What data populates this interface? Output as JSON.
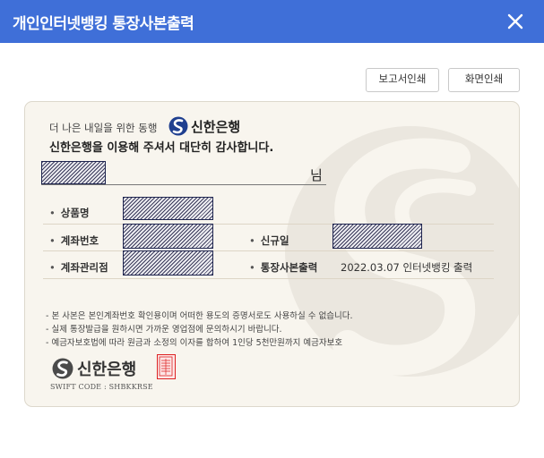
{
  "window": {
    "title": "개인인터넷뱅킹 통장사본출력"
  },
  "toolbar": {
    "report_print": "보고서인쇄",
    "screen_print": "화면인쇄"
  },
  "greeting": {
    "line1": "더 나은 내일을 위한 동행",
    "brand": "신한은행",
    "line2": "신한은행을 이용해 주셔서 대단히 감사합니다."
  },
  "customer": {
    "suffix": "님"
  },
  "fields": {
    "product_label": "상품명",
    "account_label": "계좌번호",
    "new_label": "신규일",
    "branch_label": "계좌관리점",
    "print_label": "통장사본출력",
    "print_value": "2022.03.07 인터넷뱅킹 출력"
  },
  "notes": [
    "-  본 사본은 본인계좌번호 확인용이며 어떠한 용도의 증명서로도 사용하실 수 없습니다.",
    "-  실제 통장발급을 원하시면 가까운 영업점에 문의하시기 바랍니다.",
    "-  예금자보호법에 따라 원금과 소정의 이자를 합하여 1인당 5천만원까지 예금자보호"
  ],
  "footer": {
    "brand": "신한은행",
    "swift": "SWIFT CODE : SHBKKRSE"
  },
  "colors": {
    "titlebar": "#3f6fd8",
    "card_bg": "#f8f5ee",
    "stamp": "#dd2222",
    "logo": "#1f3f8f"
  }
}
